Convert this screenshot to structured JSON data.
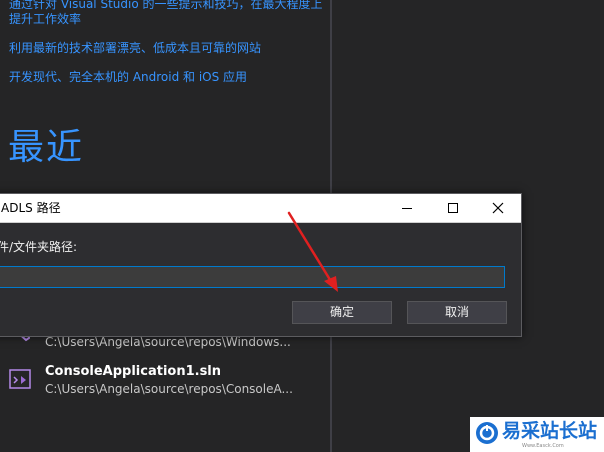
{
  "start_page": {
    "links": [
      "通过针对 Visual Studio 的一些提示和技巧，在最大程度上",
      "提升工作效率",
      "利用最新的技术部署漂亮、低成本且可靠的网站",
      "开发现代、完全本机的 Android 和 iOS 应用"
    ],
    "recent_title": "最近",
    "recent_items": [
      {
        "name": "",
        "path": "C:\\Users\\Angela\\source\\repos\\Windows..."
      },
      {
        "name": "ConsoleApplication1.sln",
        "path": "C:\\Users\\Angela\\source\\repos\\ConsoleA..."
      }
    ]
  },
  "dialog": {
    "title": "ADLS 路径",
    "label": "件/文件夹路径:",
    "input_value": "",
    "ok_label": "确定",
    "cancel_label": "取消",
    "minimize_icon": "minimize-icon",
    "maximize_icon": "maximize-icon",
    "close_icon": "close-icon"
  },
  "watermark": {
    "text": "易采站长站",
    "sub": "Www.Easck.Com"
  },
  "colors": {
    "accent_link": "#3794ff",
    "background": "#252526",
    "annotation_arrow": "#e02020"
  }
}
